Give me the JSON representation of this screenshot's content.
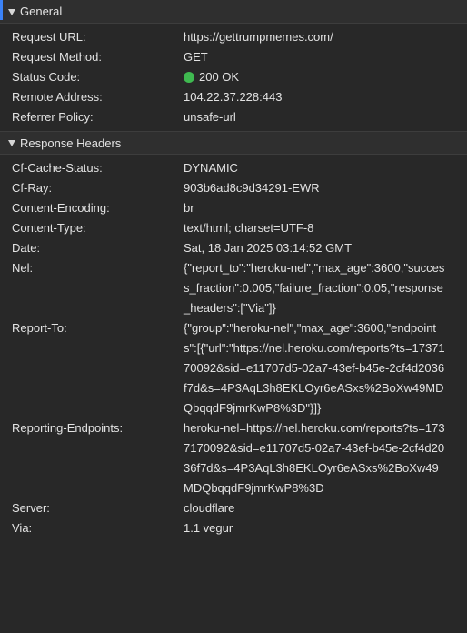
{
  "general": {
    "title": "General",
    "request_url_label": "Request URL:",
    "request_url": "https://gettrumpmemes.com/",
    "request_method_label": "Request Method:",
    "request_method": "GET",
    "status_code_label": "Status Code:",
    "status_code": "200 OK",
    "status_color": "#3fb950",
    "remote_address_label": "Remote Address:",
    "remote_address": "104.22.37.228:443",
    "referrer_policy_label": "Referrer Policy:",
    "referrer_policy": "unsafe-url"
  },
  "response_headers": {
    "title": "Response Headers",
    "items": [
      {
        "name": "Cf-Cache-Status:",
        "value": "DYNAMIC"
      },
      {
        "name": "Cf-Ray:",
        "value": "903b6ad8c9d34291-EWR"
      },
      {
        "name": "Content-Encoding:",
        "value": "br"
      },
      {
        "name": "Content-Type:",
        "value": "text/html; charset=UTF-8"
      },
      {
        "name": "Date:",
        "value": "Sat, 18 Jan 2025 03:14:52 GMT"
      },
      {
        "name": "Nel:",
        "value": "{\"report_to\":\"heroku-nel\",\"max_age\":3600,\"success_fraction\":0.005,\"failure_fraction\":0.05,\"response_headers\":[\"Via\"]}"
      },
      {
        "name": "Report-To:",
        "value": "{\"group\":\"heroku-nel\",\"max_age\":3600,\"endpoints\":[{\"url\":\"https://nel.heroku.com/reports?ts=1737170092&sid=e11707d5-02a7-43ef-b45e-2cf4d2036f7d&s=4P3AqL3h8EKLOyr6eASxs%2BoXw49MDQbqqdF9jmrKwP8%3D\"}]}"
      },
      {
        "name": "Reporting-Endpoints:",
        "value": "heroku-nel=https://nel.heroku.com/reports?ts=1737170092&sid=e11707d5-02a7-43ef-b45e-2cf4d2036f7d&s=4P3AqL3h8EKLOyr6eASxs%2BoXw49MDQbqqdF9jmrKwP8%3D"
      },
      {
        "name": "Server:",
        "value": "cloudflare"
      },
      {
        "name": "Via:",
        "value": "1.1 vegur"
      }
    ]
  },
  "icons": {
    "section_toggle": "triangle-down-icon",
    "status": "status-dot-icon"
  }
}
